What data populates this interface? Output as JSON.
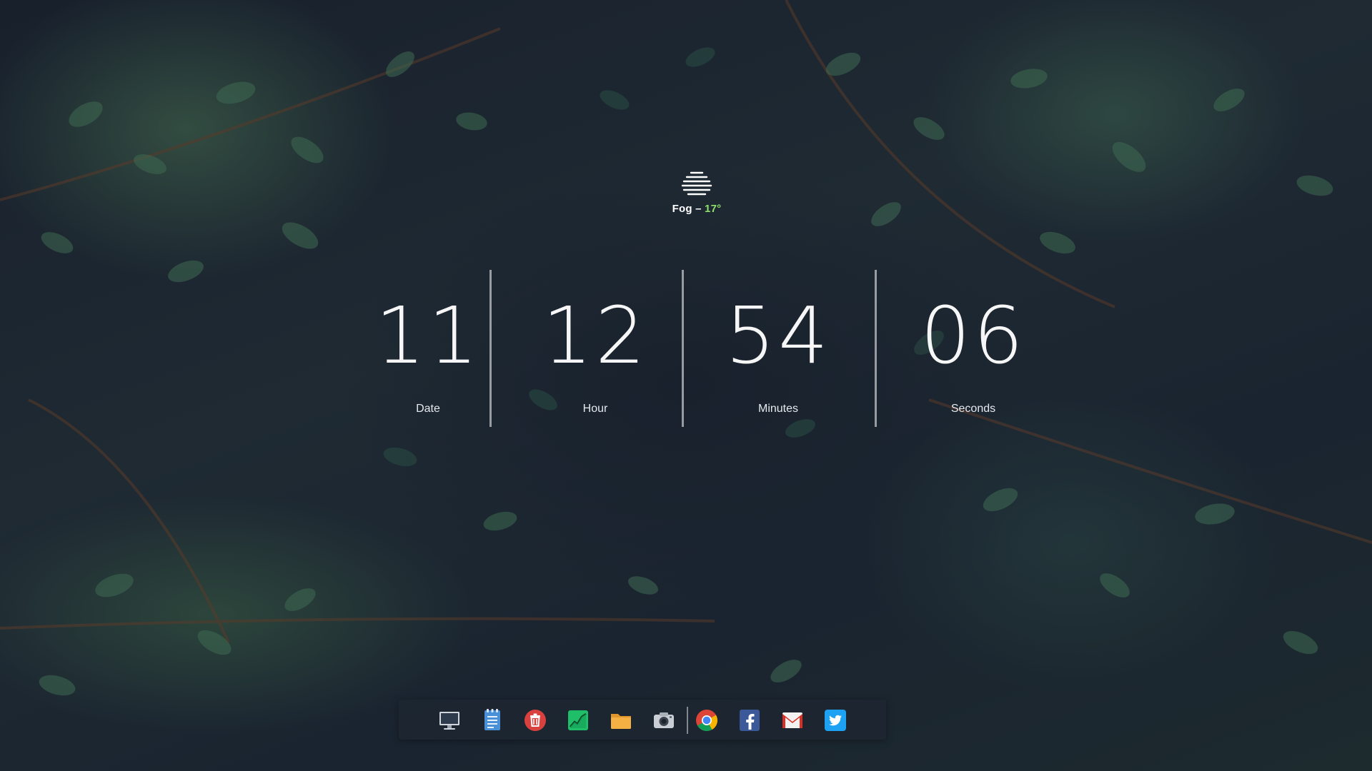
{
  "weather": {
    "condition": "Fog",
    "separator": " – ",
    "temperature": "17°",
    "icon": "fog-icon"
  },
  "clock": {
    "units": [
      {
        "value": "11",
        "label": "Date"
      },
      {
        "value": "12",
        "label": "Hour"
      },
      {
        "value": "54",
        "label": "Minutes"
      },
      {
        "value": "06",
        "label": "Seconds"
      }
    ]
  },
  "dock": {
    "items": [
      {
        "icon": "monitor-icon"
      },
      {
        "icon": "notes-icon"
      },
      {
        "icon": "trash-icon"
      },
      {
        "icon": "system-monitor-icon"
      },
      {
        "icon": "folder-icon"
      },
      {
        "icon": "camera-icon"
      },
      {
        "icon": "chrome-icon"
      },
      {
        "icon": "facebook-icon"
      },
      {
        "icon": "gmail-icon"
      },
      {
        "icon": "twitter-icon"
      }
    ]
  },
  "colors": {
    "temperature_accent": "#8fe06a",
    "clock_text": "#ffffff",
    "background": "#1b2230"
  }
}
